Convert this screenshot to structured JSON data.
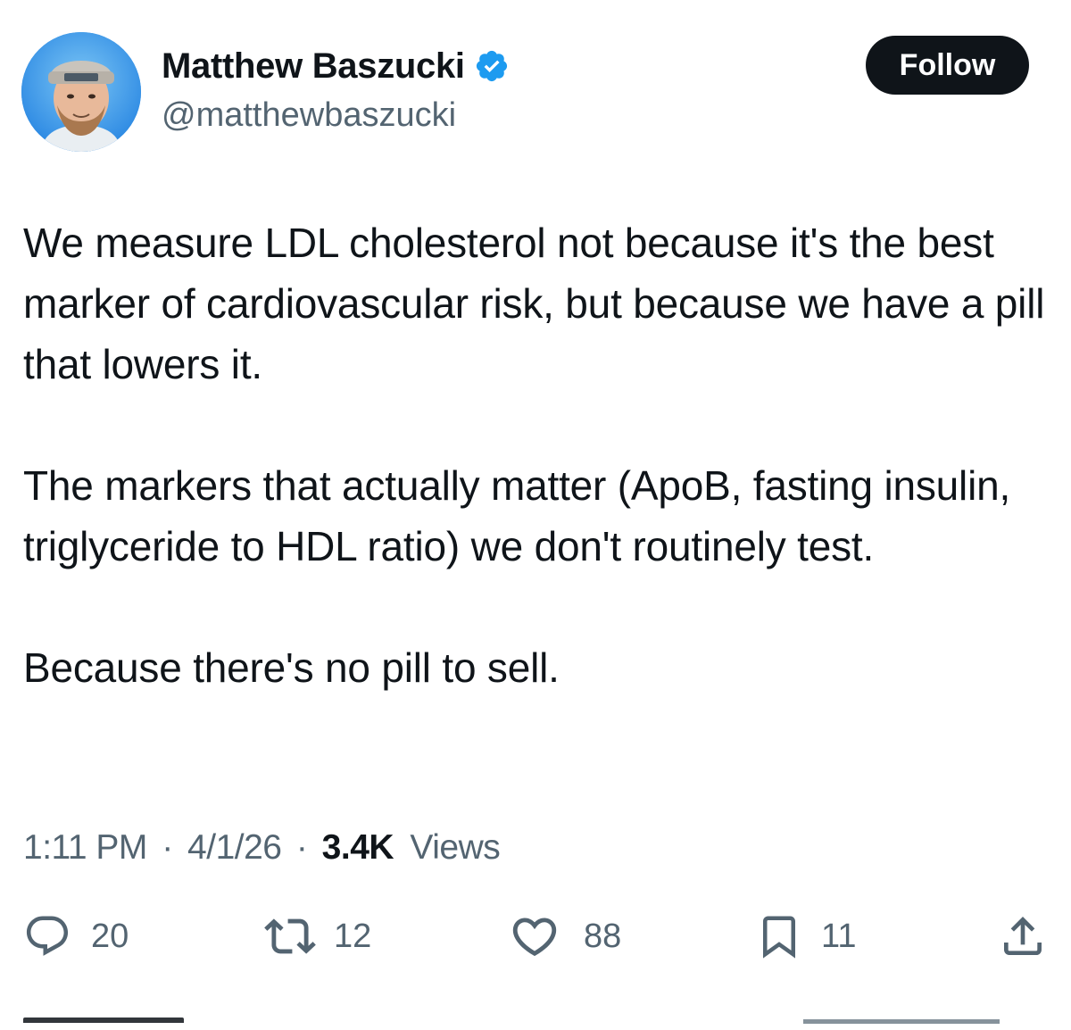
{
  "author": {
    "display_name": "Matthew Baszucki",
    "handle": "@matthewbaszucki",
    "verified": true,
    "verified_color": "#1d9bf0"
  },
  "follow_button": {
    "label": "Follow"
  },
  "tweet": {
    "paragraphs": [
      "We measure LDL cholesterol not because it's the best marker of cardiovascular risk, but because we have a pill that lowers it.",
      "The markers that actually matter (ApoB, fasting insulin, triglyceride to HDL ratio) we don't routinely test.",
      "Because there's no pill to sell."
    ]
  },
  "meta": {
    "time": "1:11 PM",
    "separator": "·",
    "date": "4/1/26",
    "views_count": "3.4K",
    "views_label": "Views"
  },
  "actions": {
    "replies": {
      "icon": "reply-icon",
      "count": "20"
    },
    "reposts": {
      "icon": "repost-icon",
      "count": "12"
    },
    "likes": {
      "icon": "heart-icon",
      "count": "88"
    },
    "bookmarks": {
      "icon": "bookmark-icon",
      "count": "11"
    },
    "share": {
      "icon": "share-icon"
    }
  },
  "colors": {
    "text_primary": "#0f1419",
    "text_secondary": "#536471",
    "button_bg": "#0f1419"
  }
}
